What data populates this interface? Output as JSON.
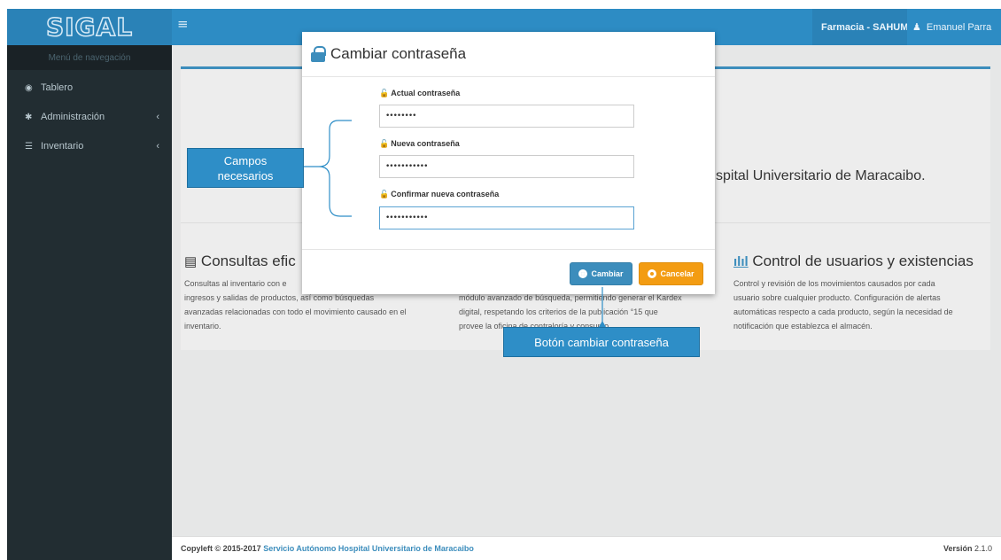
{
  "app": {
    "logo": "SIGAL",
    "menu_icon": "hamburger-icon"
  },
  "topbar": {
    "pharmacy": "Farmacia - SAHUM",
    "user": "Emanuel Parra",
    "user_icon": "user-icon"
  },
  "sidebar": {
    "header": "Menú de navegación",
    "items": [
      {
        "label": "Tablero",
        "icon": "dashboard-icon"
      },
      {
        "label": "Administración",
        "icon": "gear-icon"
      },
      {
        "label": "Inventario",
        "icon": "list-icon"
      }
    ]
  },
  "main": {
    "welcome_text": "spital Universitario de Maracaibo.",
    "features": [
      {
        "title": "Consultas efic",
        "text_l1": "Consultas al inventario con e",
        "text_l2": "ingresos y salidas de productos, así como búsquedas",
        "text_l3": "avanzadas relacionadas con todo el movimiento causado en el",
        "text_l4": "inventario."
      },
      {
        "title": "",
        "text_l1": "módulo avanzado de búsqueda, permitiendo generar el Kardex",
        "text_l2": "digital, respetando los criterios de la publicación °15 que",
        "text_l3": "provee la oficina de contraloría y consumo."
      },
      {
        "title": "Control de usuarios y existencias",
        "text_l1": "Control y revisión de los movimientos causados por cada",
        "text_l2": "usuario sobre cualquier producto. Configuración de alertas",
        "text_l3": "automáticas respecto a cada producto, según la necesidad de",
        "text_l4": "notificación que establezca el almacén."
      }
    ]
  },
  "modal": {
    "title": "Cambiar contraseña",
    "fields": [
      {
        "label": "Actual contraseña",
        "value": "••••••••"
      },
      {
        "label": "Nueva contraseña",
        "value": "•••••••••••"
      },
      {
        "label": "Confirmar nueva contraseña",
        "value": "•••••••••••"
      }
    ],
    "cambiar_label": "Cambiar",
    "cancelar_label": "Cancelar"
  },
  "annotations": {
    "campos_l1": "Campos",
    "campos_l2": "necesarios",
    "boton": "Botón cambiar contraseña"
  },
  "footer": {
    "copyleft": "Copyleft © 2015-2017",
    "org": "Servicio Autónomo Hospital Universitario de Maracaibo",
    "version_label": "Versión",
    "version": "2.1.0"
  },
  "colors": {
    "primary": "#3c8dbc",
    "sidebar": "#222d32",
    "warning": "#f39c12",
    "callout": "#2e8ec7"
  }
}
